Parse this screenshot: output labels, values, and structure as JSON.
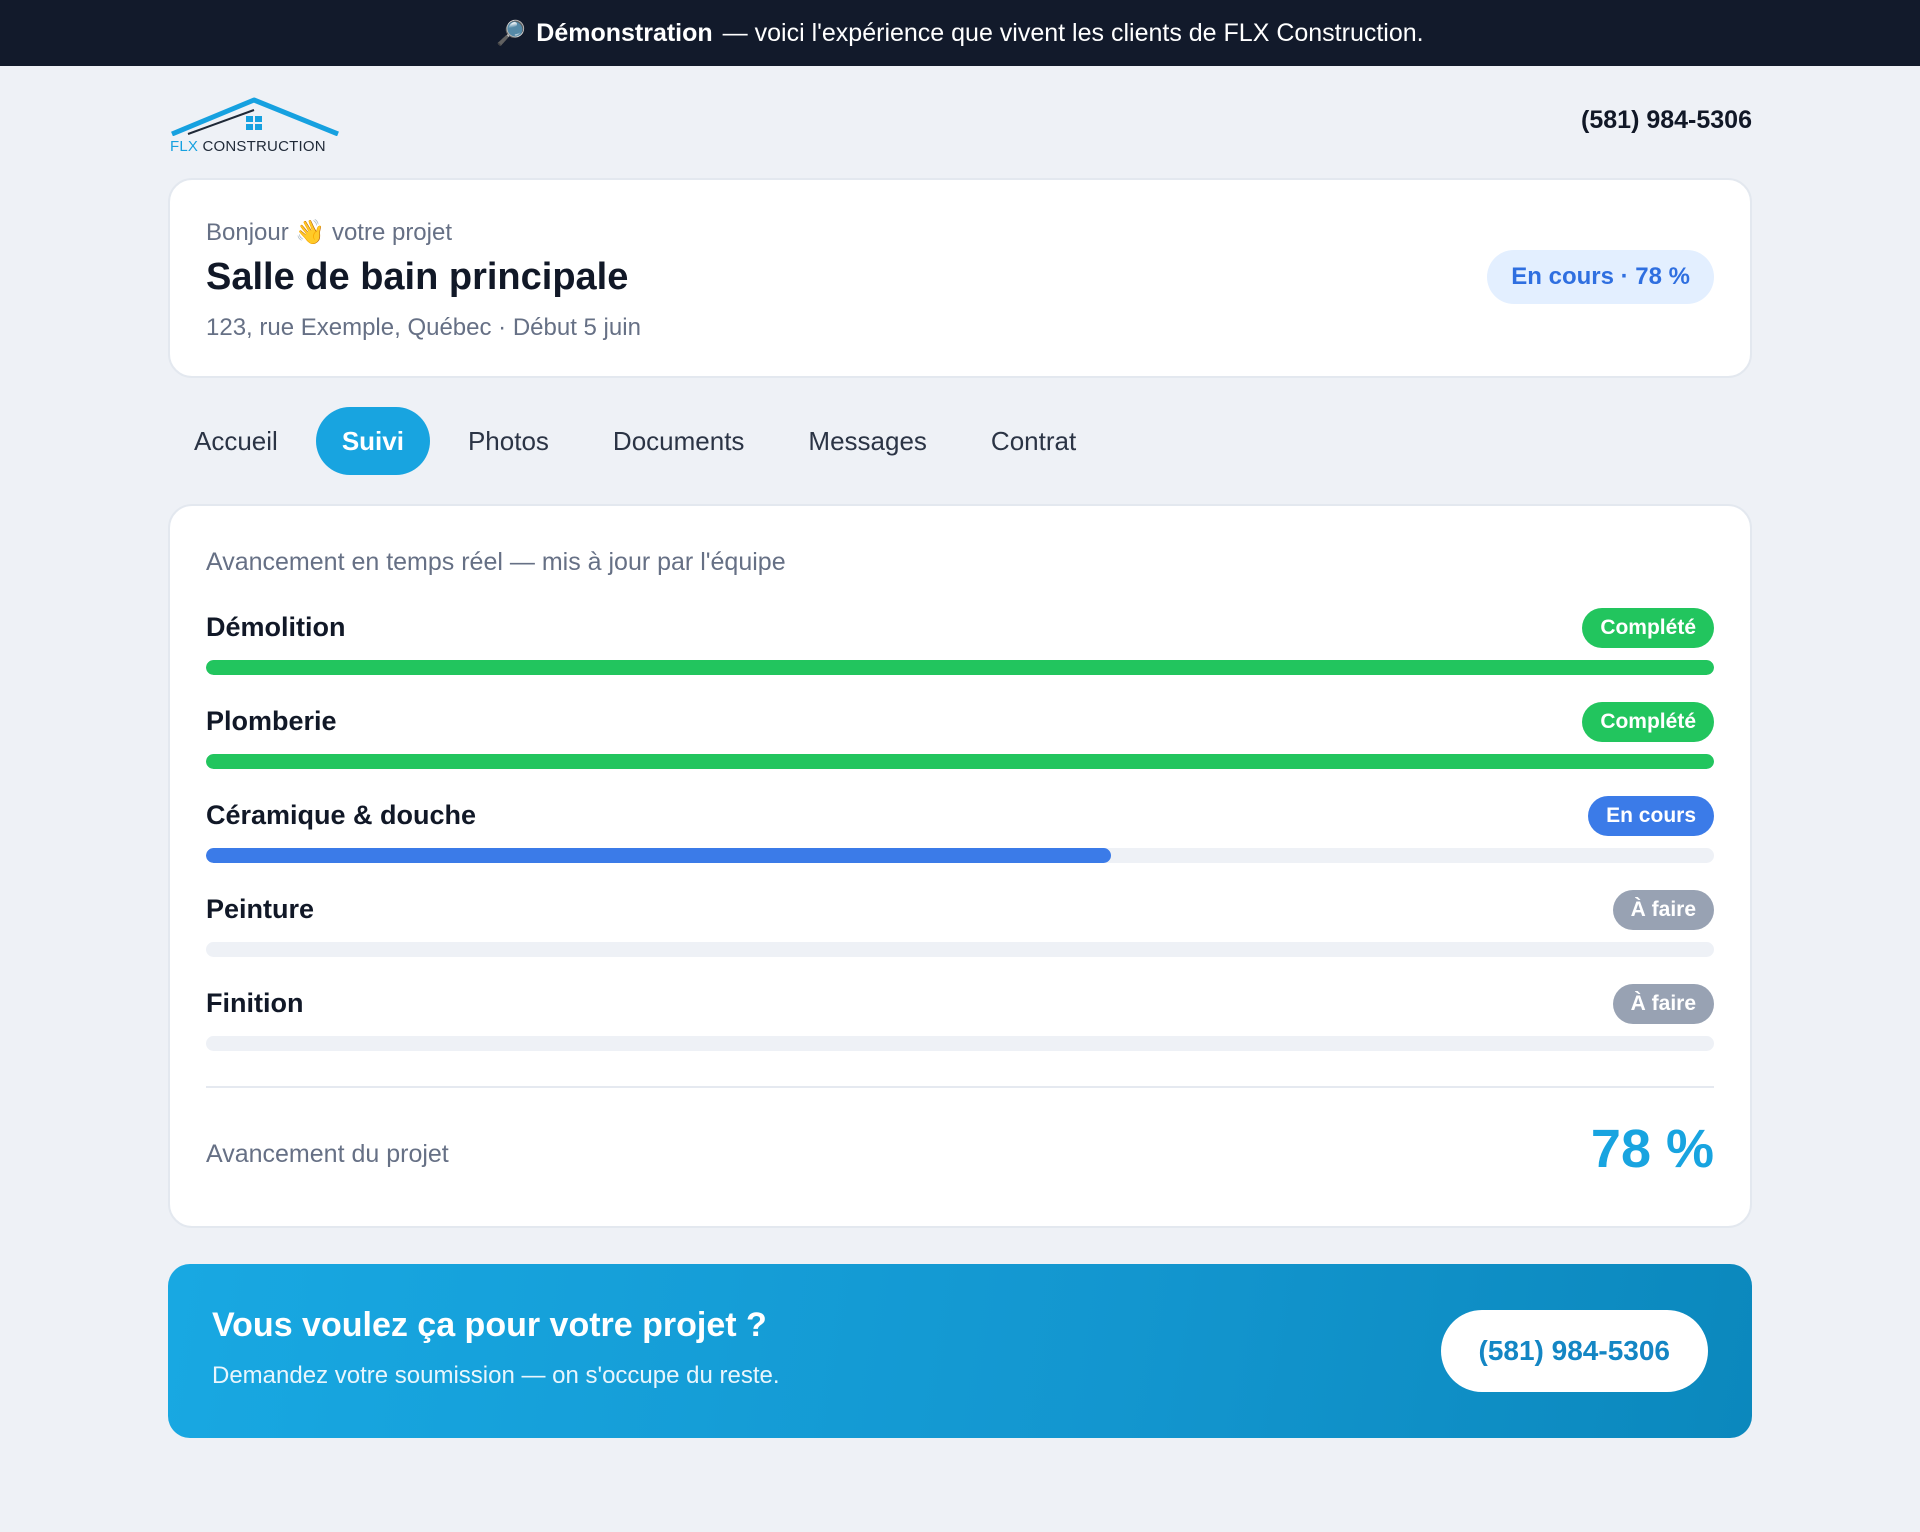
{
  "banner": {
    "icon": "magnifier-icon",
    "strong": "Démonstration",
    "text": "— voici l'expérience que vivent les clients de FLX Construction."
  },
  "header": {
    "logo": {
      "part1": "FLX",
      "part2": "CONSTRUCTION"
    },
    "phone": "(581) 984-5306"
  },
  "project": {
    "greeting": "Bonjour 👋 votre projet",
    "title": "Salle de bain principale",
    "address": "123, rue Exemple, Québec · Début 5 juin",
    "status": "En cours · 78 %"
  },
  "tabs": [
    {
      "label": "Accueil",
      "active": false
    },
    {
      "label": "Suivi",
      "active": true
    },
    {
      "label": "Photos",
      "active": false
    },
    {
      "label": "Documents",
      "active": false
    },
    {
      "label": "Messages",
      "active": false
    },
    {
      "label": "Contrat",
      "active": false
    }
  ],
  "tracking": {
    "subtitle": "Avancement en temps réel — mis à jour par l'équipe",
    "stages": [
      {
        "name": "Démolition",
        "status": "Complété",
        "progress": 100,
        "color": "#22c55e"
      },
      {
        "name": "Plomberie",
        "status": "Complété",
        "progress": 100,
        "color": "#22c55e"
      },
      {
        "name": "Céramique & douche",
        "status": "En cours",
        "progress": 60,
        "color": "#3b7be8"
      },
      {
        "name": "Peinture",
        "status": "À faire",
        "progress": 0,
        "color": "#98a2b3"
      },
      {
        "name": "Finition",
        "status": "À faire",
        "progress": 0,
        "color": "#98a2b3"
      }
    ],
    "overall_label": "Avancement du projet",
    "overall_value": "78 %"
  },
  "cta": {
    "heading": "Vous voulez ça pour votre projet ?",
    "text": "Demandez votre soumission — on s'occupe du reste.",
    "button": "(581) 984-5306"
  },
  "colors": {
    "brand": "#18a4e0",
    "banner_bg": "#121a2b",
    "complete": "#22c55e",
    "in_progress": "#3b7be8",
    "todo": "#98a2b3"
  }
}
